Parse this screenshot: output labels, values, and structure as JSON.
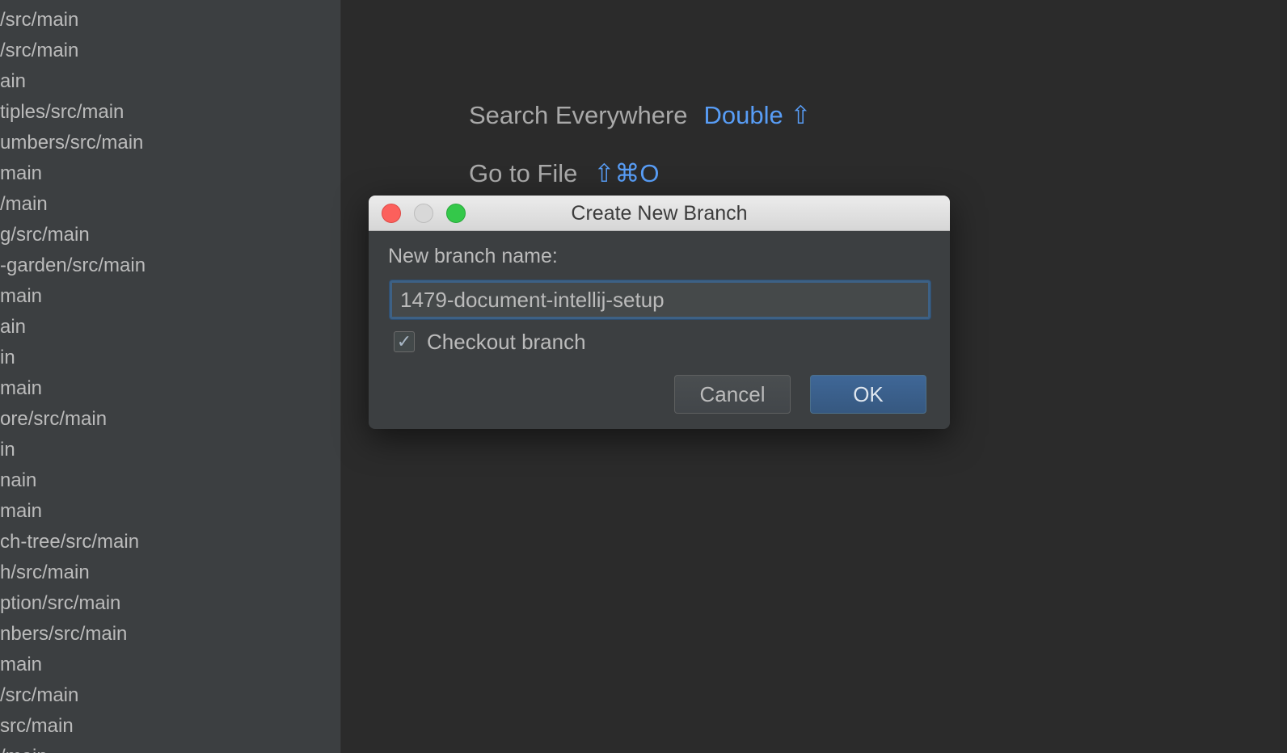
{
  "sidebar": {
    "items": [
      {
        "label": "/src/main"
      },
      {
        "label": "/src/main"
      },
      {
        "label": "ain"
      },
      {
        "label": "tiples/src/main"
      },
      {
        "label": "umbers/src/main"
      },
      {
        "label": "main"
      },
      {
        "label": "/main"
      },
      {
        "label": "g/src/main"
      },
      {
        "label": "-garden/src/main"
      },
      {
        "label": "main"
      },
      {
        "label": "ain"
      },
      {
        "label": "in"
      },
      {
        "label": "main"
      },
      {
        "label": "ore/src/main"
      },
      {
        "label": "in"
      },
      {
        "label": "nain"
      },
      {
        "label": "main"
      },
      {
        "label": "ch-tree/src/main"
      },
      {
        "label": "h/src/main"
      },
      {
        "label": "ption/src/main"
      },
      {
        "label": "nbers/src/main"
      },
      {
        "label": "main"
      },
      {
        "label": "/src/main"
      },
      {
        "label": "src/main"
      },
      {
        "label": "/main"
      }
    ]
  },
  "main": {
    "hints": [
      {
        "label": "Search Everywhere",
        "shortcut": "Double ⇧"
      },
      {
        "label": "Go to File",
        "shortcut": "⇧⌘O"
      }
    ]
  },
  "dialog": {
    "title": "Create New Branch",
    "field_label": "New branch name:",
    "field_value": "1479-document-intellij-setup",
    "checkbox_label": "Checkout branch",
    "checkbox_checked": true,
    "checkmark": "✓",
    "cancel_label": "Cancel",
    "ok_label": "OK"
  }
}
